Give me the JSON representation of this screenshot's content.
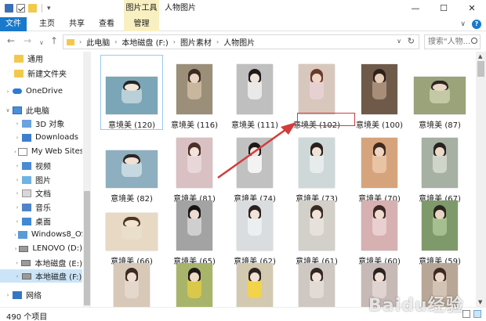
{
  "titlebar": {
    "tool_tab": "图片工具",
    "window_title": "人物图片",
    "minimize": "—",
    "maximize": "☐",
    "close": "✕"
  },
  "ribbon": {
    "tabs": [
      "文件",
      "主页",
      "共享",
      "查看",
      "管理"
    ]
  },
  "address": {
    "crumbs": [
      "此电脑",
      "本地磁盘 (F:)",
      "图片素材",
      "人物图片"
    ],
    "search_placeholder": "搜索\"人物...",
    "back": "←",
    "forward": "→",
    "history": "∨",
    "up": "↑",
    "refresh": "↻",
    "crumb_sep": "›"
  },
  "sidebar": {
    "items": [
      {
        "label": "通用",
        "icon": "folder-icon"
      },
      {
        "label": "新建文件夹",
        "icon": "folder-icon"
      },
      {
        "label": "OneDrive",
        "icon": "cloud-icon"
      },
      {
        "label": "此电脑",
        "icon": "computer-icon"
      },
      {
        "label": "3D 对象",
        "icon": "3d-objects-icon"
      },
      {
        "label": "Downloads",
        "icon": "downloads-icon"
      },
      {
        "label": "My Web Sites o",
        "icon": "web-sites-icon"
      },
      {
        "label": "视频",
        "icon": "video-icon"
      },
      {
        "label": "图片",
        "icon": "pictures-icon"
      },
      {
        "label": "文档",
        "icon": "documents-icon"
      },
      {
        "label": "音乐",
        "icon": "music-icon"
      },
      {
        "label": "桌面",
        "icon": "desktop-icon"
      },
      {
        "label": "Windows8_OS",
        "icon": "drive-icon"
      },
      {
        "label": "LENOVO (D:)",
        "icon": "drive-icon"
      },
      {
        "label": "本地磁盘 (E:)",
        "icon": "drive-icon"
      },
      {
        "label": "本地磁盘 (F:)",
        "icon": "drive-icon"
      },
      {
        "label": "网络",
        "icon": "network-icon"
      }
    ]
  },
  "files": [
    {
      "name": "意境美 (120)"
    },
    {
      "name": "意境美 (116)"
    },
    {
      "name": "意境美 (111)"
    },
    {
      "name": "意境美 (102)"
    },
    {
      "name": "意境美 (100)"
    },
    {
      "name": "意境美 (87)"
    },
    {
      "name": "意境美 (82)"
    },
    {
      "name": "意境美 (81)"
    },
    {
      "name": "意境美 (74)"
    },
    {
      "name": "意境美 (73)"
    },
    {
      "name": "意境美 (70)"
    },
    {
      "name": "意境美 (67)"
    },
    {
      "name": "意境美 (66)"
    },
    {
      "name": "意境美 (65)"
    },
    {
      "name": "意境美 (62)"
    },
    {
      "name": "意境美 (61)"
    },
    {
      "name": "意境美 (60)"
    },
    {
      "name": "意境美 (59)"
    },
    {
      "name": ""
    },
    {
      "name": ""
    },
    {
      "name": ""
    },
    {
      "name": ""
    },
    {
      "name": ""
    },
    {
      "name": ""
    }
  ],
  "status": {
    "count": "490 个项目"
  },
  "watermark": "Baidu经验",
  "colors": {
    "accent": "#1979ca",
    "tool_tab": "#f9f0c2",
    "selection": "#cce4f7",
    "annotation": "#d23c3c"
  }
}
